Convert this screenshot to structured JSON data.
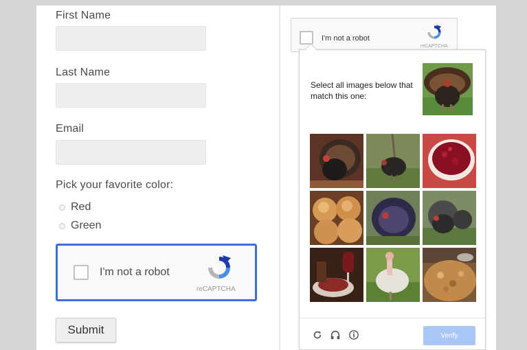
{
  "form": {
    "first_name_label": "First Name",
    "last_name_label": "Last Name",
    "email_label": "Email",
    "color_question": "Pick your favorite color:",
    "color_options": [
      "Red",
      "Green"
    ],
    "submit_label": "Submit"
  },
  "recaptcha_main": {
    "checkbox_label": "I'm not a robot",
    "brand": "reCAPTCHA"
  },
  "recaptcha_mini": {
    "checkbox_label": "I'm not a robot",
    "brand": "reCAPTCHA"
  },
  "challenge": {
    "instruction": "Select all images below that match this one:",
    "sample_image": "turkey",
    "tiles": [
      "turkey",
      "turkey",
      "cranberry-sauce",
      "bread-rolls",
      "turkey",
      "turkey",
      "wine-and-food",
      "turkey",
      "stuffing"
    ],
    "footer_icons": [
      "reload-icon",
      "headphones-icon",
      "info-icon"
    ],
    "verify_label": "Verify"
  },
  "colors": {
    "accent_border": "#3b6fd1",
    "verify_button": "#a8c7f6",
    "recaptcha_blue": "#1c3aa9",
    "recaptcha_lightblue": "#4a90e2",
    "recaptcha_grey": "#b4b4b4"
  }
}
